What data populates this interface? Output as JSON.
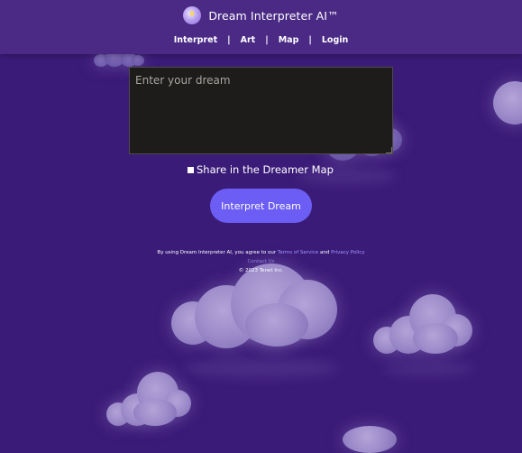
{
  "header": {
    "title": "Dream Interpreter AI™",
    "logo_icon": "crystal-ball-icon",
    "nav": [
      {
        "label": "Interpret"
      },
      {
        "label": "Art"
      },
      {
        "label": "Map"
      },
      {
        "label": "Login"
      }
    ],
    "separator": "|"
  },
  "form": {
    "dream_placeholder": "Enter your dream",
    "dream_value": "",
    "share_label": "Share in the Dreamer Map",
    "share_checked": false,
    "submit_label": "Interpret Dream"
  },
  "footer": {
    "terms_prefix": "By using Dream Interpreter AI, you agree to our ",
    "terms_link": "Terms of Service",
    "and_text": " and ",
    "privacy_link": "Privacy Policy",
    "contact_link": "Contact Us",
    "copyright": "© 2023 Tenet Inc."
  },
  "colors": {
    "background": "#3b1b78",
    "header_bg": "#4a2a85",
    "button": "#6c5df4",
    "textarea_bg": "#1e1c1b",
    "link": "#a694ff"
  }
}
